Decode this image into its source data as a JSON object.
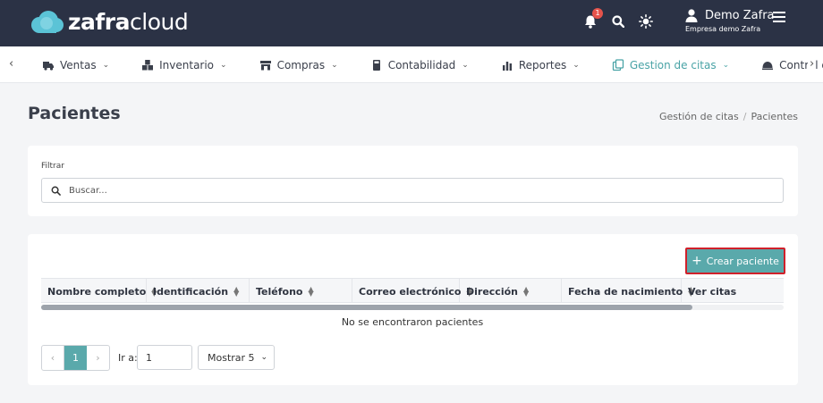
{
  "app": {
    "logo_bold": "zafra",
    "logo_light": "cloud",
    "brand_color": "#5bc3d6",
    "accent_color": "#5aa9ab"
  },
  "header": {
    "notification_count": "1",
    "user_name": "Demo Zafra",
    "company": "Empresa demo Zafra",
    "icons": [
      "bell-icon",
      "search-icon",
      "sun-icon",
      "user-icon",
      "menu-icon"
    ]
  },
  "nav": {
    "items": [
      {
        "label": "Ventas",
        "icon": "truck-icon"
      },
      {
        "label": "Inventario",
        "icon": "boxes-icon"
      },
      {
        "label": "Compras",
        "icon": "store-icon"
      },
      {
        "label": "Contabilidad",
        "icon": "calculator-icon"
      },
      {
        "label": "Reportes",
        "icon": "bar-chart-icon"
      },
      {
        "label": "Gestion de citas",
        "icon": "copy-icon"
      },
      {
        "label": "Control de mesas",
        "icon": "cloche-icon"
      }
    ]
  },
  "page": {
    "title": "Pacientes",
    "breadcrumb": [
      "Gestión de citas",
      "Pacientes"
    ]
  },
  "filter": {
    "label": "Filtrar",
    "placeholder": "Buscar..."
  },
  "table": {
    "create_button": "Crear paciente",
    "columns": [
      "Nombre completo",
      "Identificación",
      "Teléfono",
      "Correo electrónico",
      "Dirección",
      "Fecha de nacimiento",
      "Ver citas"
    ],
    "empty_message": "No se encontraron pacientes"
  },
  "pagination": {
    "current_page": "1",
    "goto_label": "Ir a:",
    "goto_value": "1",
    "page_size_label": "Mostrar 5"
  }
}
